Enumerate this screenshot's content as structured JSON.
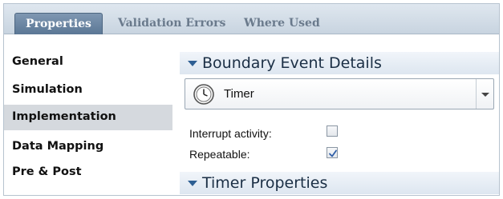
{
  "tabs": [
    {
      "label": "Properties",
      "active": true
    },
    {
      "label": "Validation Errors",
      "active": false
    },
    {
      "label": "Where Used",
      "active": false
    }
  ],
  "nav": {
    "items": [
      {
        "label": "General"
      },
      {
        "label": "Simulation"
      },
      {
        "label": "Implementation",
        "selected": true
      },
      {
        "label": "Data Mapping"
      },
      {
        "label": "Pre & Post"
      }
    ]
  },
  "details": {
    "section_title": "Boundary Event Details",
    "event_type": {
      "value": "Timer",
      "icon": "clock-icon"
    },
    "fields": [
      {
        "label": "Interrupt activity:",
        "checked": false
      },
      {
        "label": "Repeatable:",
        "checked": true
      }
    ],
    "timer_section_title": "Timer Properties"
  },
  "colors": {
    "tab_active_bg": "#6a86a4",
    "nav_selected_bg": "#d5d9de",
    "section_header_text": "#1b2f45",
    "checkmark": "#2f5fa8"
  }
}
